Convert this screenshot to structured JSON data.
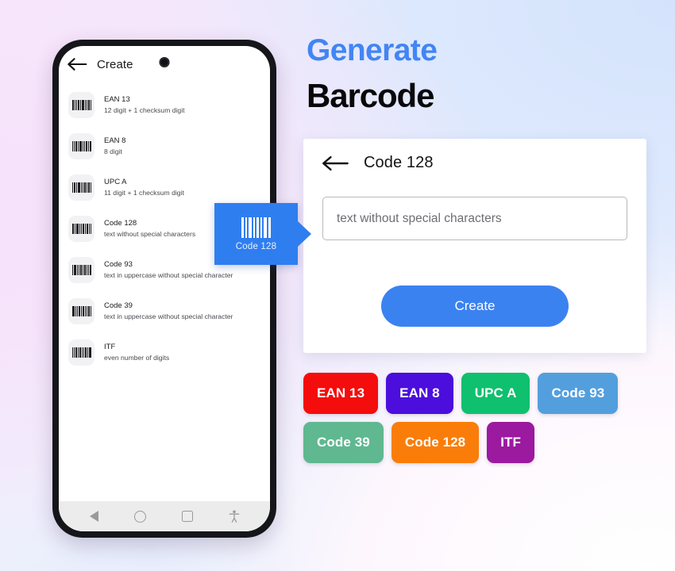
{
  "background": {
    "gradient_top_right": "#d4e3fc",
    "gradient_left": "#f6e2fb",
    "gradient_bottom_right": "#ffffff"
  },
  "phone": {
    "appbar": {
      "back_icon": "arrow-left-icon",
      "title": "Create"
    },
    "list": [
      {
        "icon": "barcode-icon",
        "name": "EAN 13",
        "desc": "12 digit + 1 checksum digit"
      },
      {
        "icon": "barcode-icon",
        "name": "EAN 8",
        "desc": "8 digit"
      },
      {
        "icon": "barcode-icon",
        "name": "UPC A",
        "desc": "11 digit + 1 checksum digit"
      },
      {
        "icon": "barcode-icon",
        "name": "Code 128",
        "desc": "text without special characters"
      },
      {
        "icon": "barcode-icon",
        "name": "Code 93",
        "desc": "text in uppercase without special character"
      },
      {
        "icon": "barcode-icon",
        "name": "Code 39",
        "desc": "text in uppercase without special character"
      },
      {
        "icon": "barcode-icon",
        "name": "ITF",
        "desc": "even number of digits"
      }
    ],
    "navbar": {
      "back": "nav-back-icon",
      "home": "nav-home-icon",
      "recents": "nav-recents-icon",
      "accessibility": "accessibility-icon"
    }
  },
  "callout": {
    "label": "Code 128",
    "icon": "barcode-icon",
    "color": "#2f7ef0"
  },
  "panel": {
    "kicker": "Generate",
    "kicker_color": "#4285f4",
    "headline": "Barcode"
  },
  "card": {
    "back_icon": "arrow-left-icon",
    "title": "Code 128",
    "input": {
      "value": "",
      "placeholder": "text without special characters"
    },
    "create_label": "Create",
    "create_color": "#3b82f1"
  },
  "chips": [
    {
      "label": "EAN 13",
      "color": "#f50c0c"
    },
    {
      "label": "EAN 8",
      "color": "#4b0edc"
    },
    {
      "label": "UPC A",
      "color": "#0fc06e"
    },
    {
      "label": "Code 93",
      "color": "#539fdd"
    },
    {
      "label": "Code 39",
      "color": "#5fb890"
    },
    {
      "label": "Code 128",
      "color": "#fa7d0a"
    },
    {
      "label": "ITF",
      "color": "#9b1aa0"
    }
  ]
}
